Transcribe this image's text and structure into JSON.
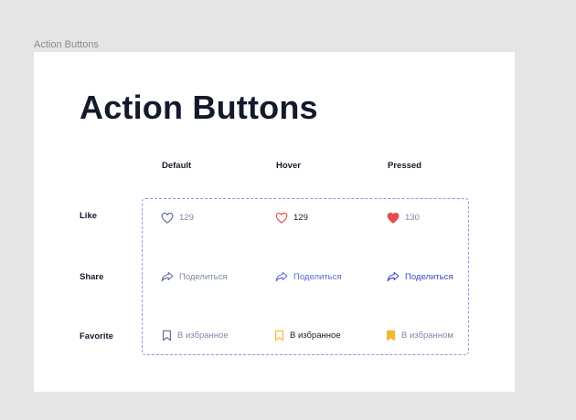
{
  "canvas": {
    "frame_label": "Action Buttons"
  },
  "page": {
    "title": "Action Buttons",
    "columns": [
      "Default",
      "Hover",
      "Pressed"
    ],
    "rows": [
      "Like",
      "Share",
      "Favorite"
    ]
  },
  "buttons": {
    "like": {
      "default": "129",
      "hover": "129",
      "pressed": "130"
    },
    "share": {
      "default": "Поделиться",
      "hover": "Поделиться",
      "pressed": "Поделиться"
    },
    "favorite": {
      "default": "В избранное",
      "hover": "В избранное",
      "pressed": "В избранном"
    }
  },
  "colors": {
    "default_text": "#7b88a8",
    "hover_like_text": "#141a2b",
    "heart_red": "#e84b4b",
    "share_hover": "#5b67d8",
    "share_pressed": "#3a47c4",
    "bookmark_yellow": "#f5b82e",
    "dashed_border": "#9b8ef2"
  },
  "icons": {
    "like": "heart-icon",
    "share": "share-arrow-icon",
    "favorite": "bookmark-icon"
  }
}
